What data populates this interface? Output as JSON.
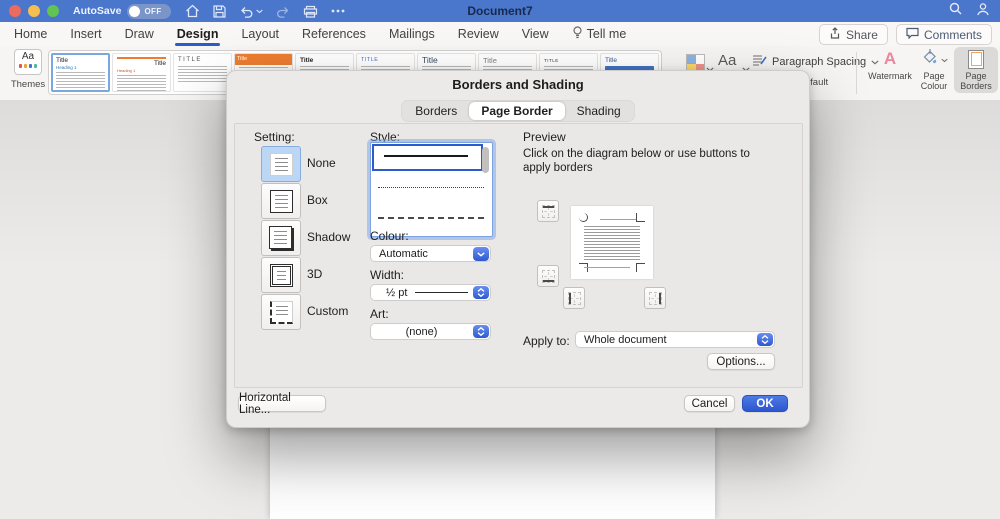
{
  "titlebar": {
    "autosave_label": "AutoSave",
    "autosave_state": "OFF",
    "document_title": "Document7"
  },
  "menubar": {
    "tabs": [
      {
        "label": "Home"
      },
      {
        "label": "Insert"
      },
      {
        "label": "Draw"
      },
      {
        "label": "Design"
      },
      {
        "label": "Layout"
      },
      {
        "label": "References"
      },
      {
        "label": "Mailings"
      },
      {
        "label": "Review"
      },
      {
        "label": "View"
      }
    ],
    "active_tab": "Design",
    "tell_me_label": "Tell me",
    "share_label": "Share",
    "comments_label": "Comments"
  },
  "ribbon": {
    "themes_label": "Themes",
    "themes_icon_text": "Aa",
    "aa_label": "Aa",
    "gallery": [
      {
        "title": "Title",
        "heading": "Heading 1"
      },
      {
        "title": "Title",
        "heading": "Heading 1"
      },
      {
        "title": "TITLE"
      },
      {
        "title": "Title"
      },
      {
        "title": "Title"
      },
      {
        "title": "TITLE"
      },
      {
        "title": "Title"
      },
      {
        "title": "Title"
      },
      {
        "title": "TITLE"
      },
      {
        "title": "Title"
      }
    ],
    "paragraph_spacing_label": "Paragraph Spacing",
    "default_label": "Default",
    "watermark_label": "Watermark",
    "watermark_icon_text": "A",
    "page_colour_label": "Page Colour",
    "page_borders_label": "Page Borders"
  },
  "dialog": {
    "title": "Borders and Shading",
    "tabs": [
      {
        "label": "Borders"
      },
      {
        "label": "Page Border"
      },
      {
        "label": "Shading"
      }
    ],
    "selected_tab": "Page Border",
    "setting_label": "Setting:",
    "settings": [
      {
        "label": "None"
      },
      {
        "label": "Box"
      },
      {
        "label": "Shadow"
      },
      {
        "label": "3D"
      },
      {
        "label": "Custom"
      }
    ],
    "selected_setting": "None",
    "style_label": "Style:",
    "style_options": [
      "solid",
      "dotted",
      "dashed"
    ],
    "selected_style": "solid",
    "colour_label": "Colour:",
    "colour_value": "Automatic",
    "width_label": "Width:",
    "width_value": "½ pt",
    "art_label": "Art:",
    "art_value": "(none)",
    "preview_label": "Preview",
    "preview_instruction": "Click on the diagram below or use buttons to apply borders",
    "apply_to_label": "Apply to:",
    "apply_to_value": "Whole document",
    "options_label": "Options...",
    "horizontal_line_label": "Horizontal Line...",
    "cancel_label": "Cancel",
    "ok_label": "OK"
  },
  "colors": {
    "accent_blue": "#2a5cc8",
    "titlebar_blue": "#4a76cb",
    "ok_button_blue": "#2c57cf",
    "selection_blue": "#2b5cc9"
  }
}
